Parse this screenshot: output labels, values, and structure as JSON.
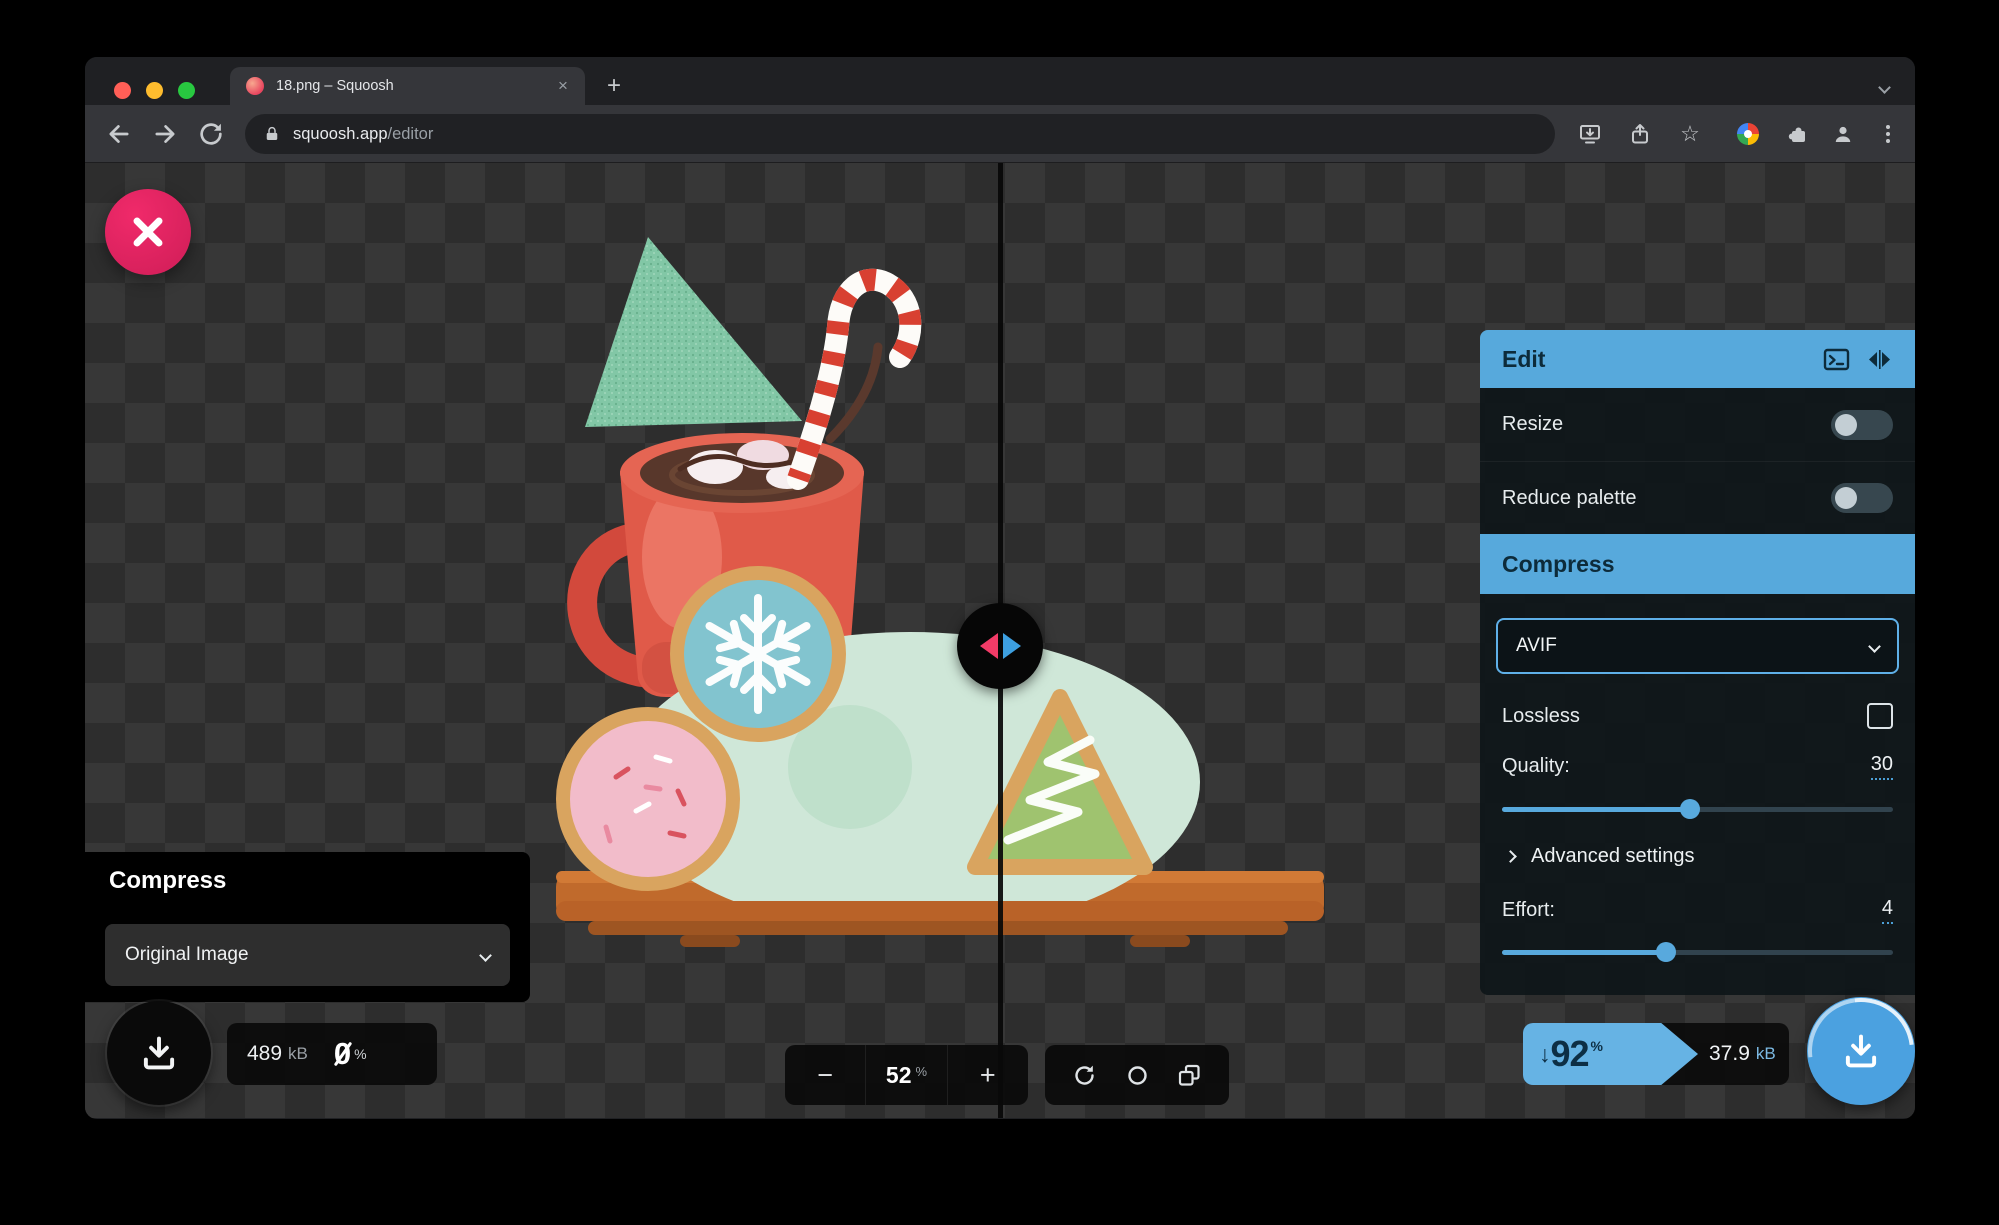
{
  "browser": {
    "tab": {
      "title": "18.png – Squoosh",
      "close_glyph": "×"
    },
    "new_tab_glyph": "+",
    "url": {
      "domain": "squoosh.app",
      "path": "/editor"
    },
    "star_glyph": "☆"
  },
  "viewer": {
    "zoom": {
      "minus": "−",
      "value": "52",
      "unit": "%",
      "plus": "+"
    }
  },
  "left_panel": {
    "title": "Compress",
    "codec_value": "Original Image",
    "size": {
      "value": "489",
      "unit": "kB"
    },
    "delta": {
      "value": "0",
      "unit": "%"
    }
  },
  "right_panel": {
    "edit": {
      "title": "Edit",
      "resize": "Resize",
      "reduce_palette": "Reduce palette"
    },
    "compress": {
      "title": "Compress",
      "codec_value": "AVIF",
      "lossless": "Lossless",
      "quality_label": "Quality:",
      "quality_value": "30",
      "advanced": "Advanced settings",
      "effort_label": "Effort:",
      "effort_value": "4"
    }
  },
  "results": {
    "arrow": "↓",
    "delta_value": "92",
    "delta_unit": "%",
    "size_value": "37.9",
    "size_unit": "kB"
  },
  "colors": {
    "accent_blue": "#57a9dc",
    "badge_blue": "#66b3e4",
    "close_pink": "#e61e5f"
  }
}
